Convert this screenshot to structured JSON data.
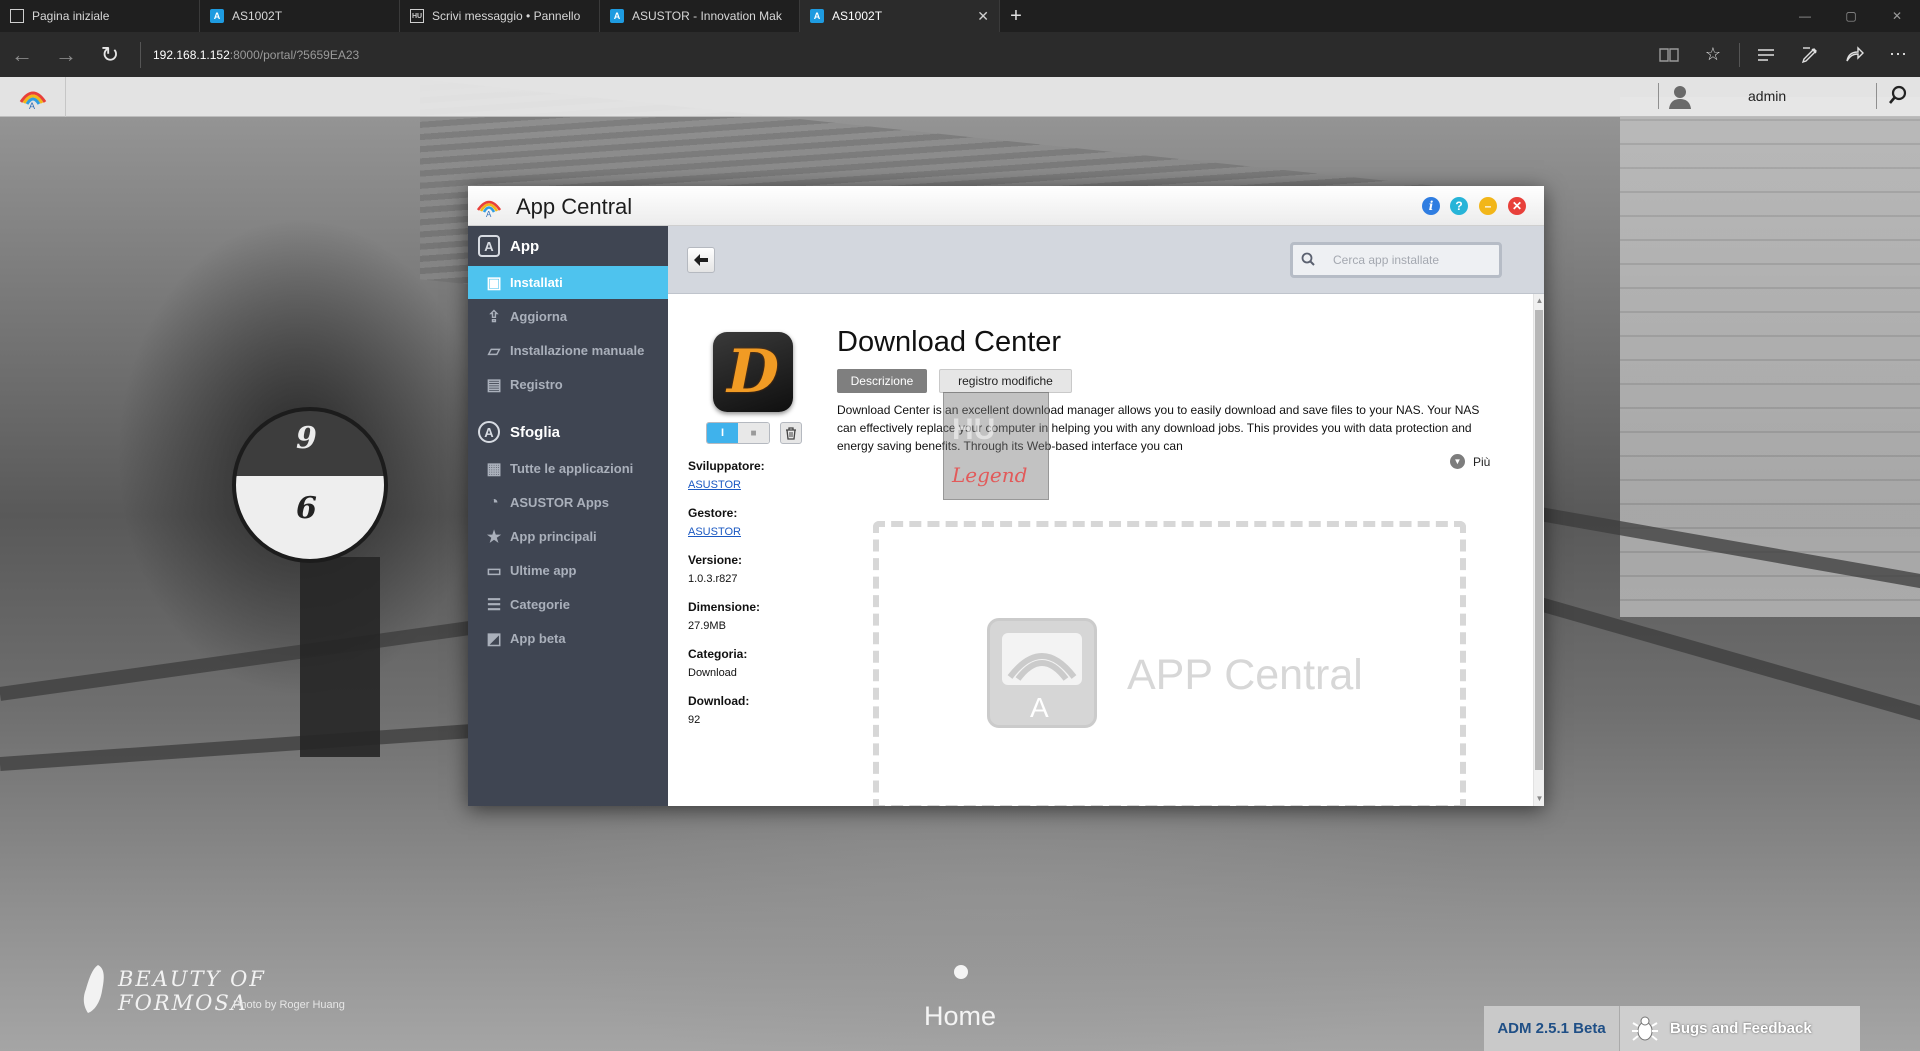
{
  "browser": {
    "tabs": [
      {
        "label": "Pagina iniziale",
        "icon": "page-icon",
        "active": false
      },
      {
        "label": "AS1002T",
        "icon": "asustor-icon",
        "active": false
      },
      {
        "label": "Scrivi messaggio • Pannello",
        "icon": "forum-icon",
        "active": false
      },
      {
        "label": "ASUSTOR - Innovation Mak",
        "icon": "asustor-icon",
        "active": false
      },
      {
        "label": "AS1002T",
        "icon": "asustor-icon",
        "active": true
      }
    ],
    "new_tab_symbol": "+",
    "close_tab_symbol": "✕",
    "url_host": "192.168.1.152",
    "url_path": ":8000/portal/?5659EA23"
  },
  "adm": {
    "user": "admin",
    "wallpaper": {
      "title": "BEAUTY OF FORMOSA",
      "credit": "Photo by Roger Huang"
    },
    "home_label": "Home",
    "version_badge": "ADM 2.5.1 Beta",
    "feedback_label": "Bugs and Feedback"
  },
  "app_window": {
    "title": "App Central",
    "sidebar": {
      "section_app": "App",
      "app_items": [
        {
          "label": "Installati",
          "icon": "installed-icon",
          "active": true
        },
        {
          "label": "Aggiorna",
          "icon": "update-icon",
          "active": false
        },
        {
          "label": "Installazione manuale",
          "icon": "folder-open-icon",
          "active": false
        },
        {
          "label": "Registro",
          "icon": "log-icon",
          "active": false
        }
      ],
      "section_browse": "Sfoglia",
      "browse_items": [
        {
          "label": "Tutte le applicazioni",
          "icon": "grid-icon"
        },
        {
          "label": "ASUSTOR Apps",
          "icon": "asustor-logo-icon"
        },
        {
          "label": "App principali",
          "icon": "star-icon"
        },
        {
          "label": "Ultime app",
          "icon": "new-icon"
        },
        {
          "label": "Categorie",
          "icon": "list-icon"
        },
        {
          "label": "App beta",
          "icon": "beta-icon"
        }
      ]
    },
    "search": {
      "placeholder": "Cerca app installate"
    },
    "app": {
      "name": "Download Center",
      "icon_letter": "D",
      "toggle_on": "I",
      "toggle_off": "■",
      "tab_description": "Descrizione",
      "tab_changelog": "registro modifiche",
      "description": "Download Center is an excellent download manager allows you to easily download and save files to your NAS. Your NAS can effectively replace your computer in helping you with any download jobs. This provides you with data protection and energy saving benefits. Through its Web-based interface you can",
      "more_label": "Più",
      "meta": {
        "developer_label": "Sviluppatore:",
        "developer": "ASUSTOR",
        "maintainer_label": "Gestore:",
        "maintainer": "ASUSTOR",
        "version_label": "Versione:",
        "version": "1.0.3.r827",
        "size_label": "Dimensione:",
        "size": "27.9MB",
        "category_label": "Categoria:",
        "category": "Download",
        "downloads_label": "Download:",
        "downloads": "92"
      },
      "watermark_text": "Legend",
      "placeholder_brand": "APP Central"
    }
  },
  "colors": {
    "sidebar_bg": "#3f4552",
    "sidebar_active": "#4ec3ee",
    "toolbar_bg": "#d3d7de",
    "link": "#1b59c2",
    "version_text": "#1f4f86",
    "close_button": "#e8403a",
    "minimize_button": "#f2b619",
    "help_button": "#27b4d8",
    "info_button": "#2f7de1"
  }
}
